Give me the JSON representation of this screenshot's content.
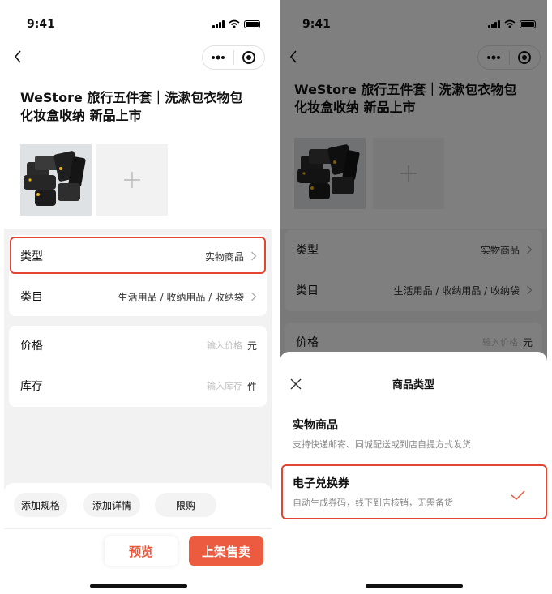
{
  "status": {
    "time": "9:41"
  },
  "product": {
    "title": "WeStore 旅行五件套｜洗漱包衣物包化妆盒收纳 新品上市"
  },
  "form": {
    "type_label": "类型",
    "type_value": "实物商品",
    "category_label": "类目",
    "category_value": "生活用品 / 收纳用品 / 收纳袋",
    "price_label": "价格",
    "price_placeholder": "输入价格",
    "price_unit": "元",
    "stock_label": "库存",
    "stock_placeholder": "输入库存",
    "stock_unit": "件"
  },
  "bottom_bar": {
    "chips": [
      "添加规格",
      "添加详情",
      "限购"
    ],
    "preview_label": "预览",
    "publish_label": "上架售卖"
  },
  "sheet": {
    "title": "商品类型",
    "options": [
      {
        "title": "实物商品",
        "desc": "支持快递邮寄、同城配送或到店自提方式发货"
      },
      {
        "title": "电子兑换券",
        "desc": "自动生成券码，线下到店核销，无需备货",
        "selected": true
      }
    ]
  },
  "colors": {
    "accent": "#ec5a3f",
    "highlight_border": "#e34433",
    "page_bg": "#f2f2f2"
  },
  "icons": [
    "back-icon",
    "more-icon",
    "target-icon",
    "plus-icon",
    "chevron-right-icon",
    "close-icon",
    "check-icon"
  ]
}
